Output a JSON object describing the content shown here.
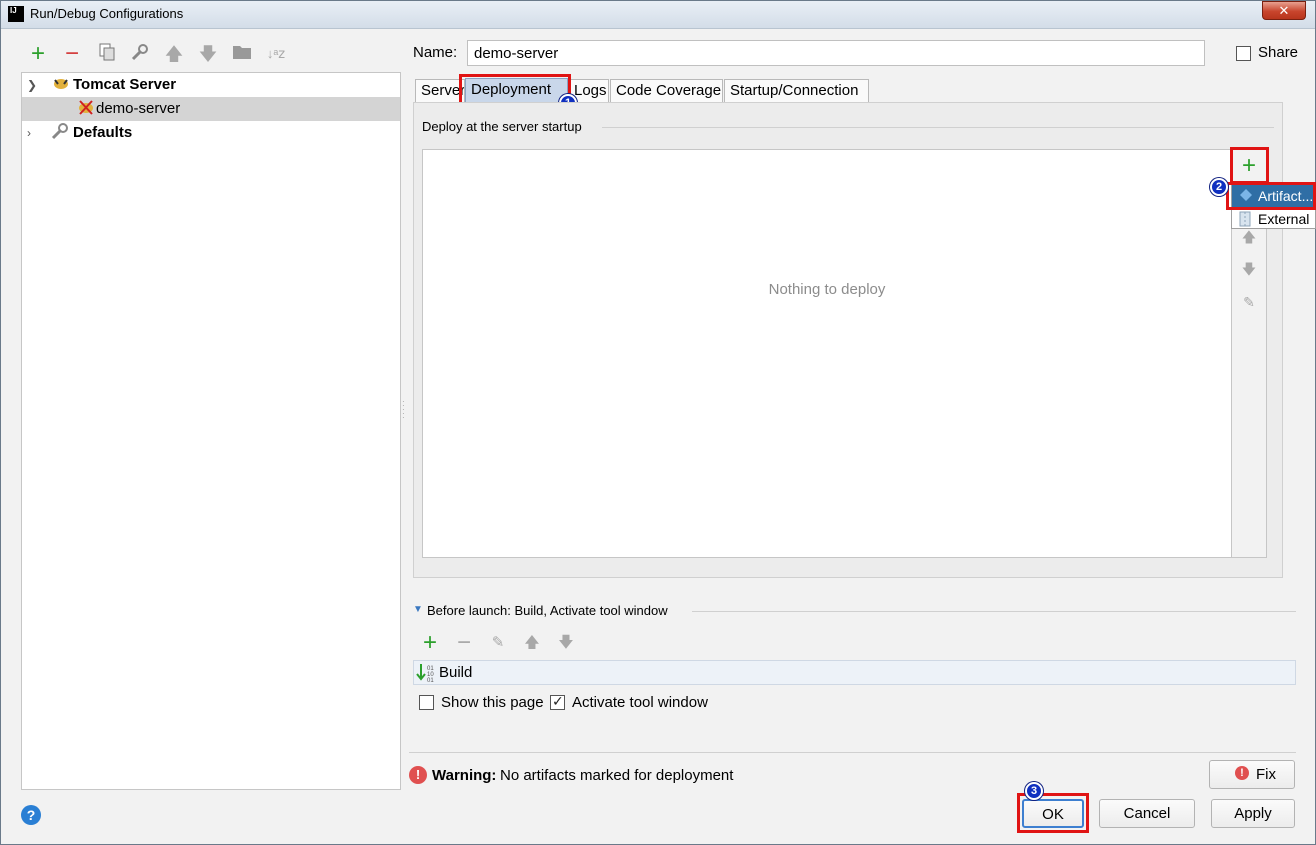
{
  "window": {
    "title": "Run/Debug Configurations",
    "close_glyph": "✕",
    "app_icon_text": "IJ"
  },
  "left_toolbar": {
    "icons": [
      "add-icon",
      "remove-icon",
      "copy-icon",
      "edit-defaults-icon",
      "move-up-icon",
      "move-down-icon",
      "folder-icon",
      "sort-icon"
    ]
  },
  "tree": {
    "items": [
      {
        "label": "Tomcat Server",
        "expanded": true
      },
      {
        "label": "demo-server",
        "selected": true
      },
      {
        "label": "Defaults",
        "expanded": false
      }
    ]
  },
  "name_field": {
    "label": "Name:",
    "value": "demo-server"
  },
  "share": {
    "label": "Share",
    "checked": false
  },
  "tabs": [
    {
      "label": "Server"
    },
    {
      "label": "Deployment",
      "active": true
    },
    {
      "label": "Logs"
    },
    {
      "label": "Code Coverage"
    },
    {
      "label": "Startup/Connection"
    }
  ],
  "deployment": {
    "section_title": "Deploy at the server startup",
    "empty_text": "Nothing to deploy",
    "popup_items": [
      "Artifact...",
      "External"
    ]
  },
  "before_launch": {
    "title": "Before launch: Build, Activate tool window",
    "tasks": [
      "Build"
    ],
    "show_this_page_label": "Show this page",
    "show_this_page_checked": false,
    "activate_tool_window_label": "Activate tool window",
    "activate_tool_window_checked": true
  },
  "warning": {
    "bold": "Warning:",
    "text": "No artifacts marked for deployment"
  },
  "buttons": {
    "fix": "Fix",
    "ok": "OK",
    "cancel": "Cancel",
    "apply": "Apply"
  },
  "annotations": {
    "badge1": "1",
    "badge2": "2",
    "badge3": "3"
  },
  "colors": {
    "highlight_red": "#e01414",
    "badge_blue": "#1030c0",
    "selection_blue": "#2f6ea5"
  }
}
